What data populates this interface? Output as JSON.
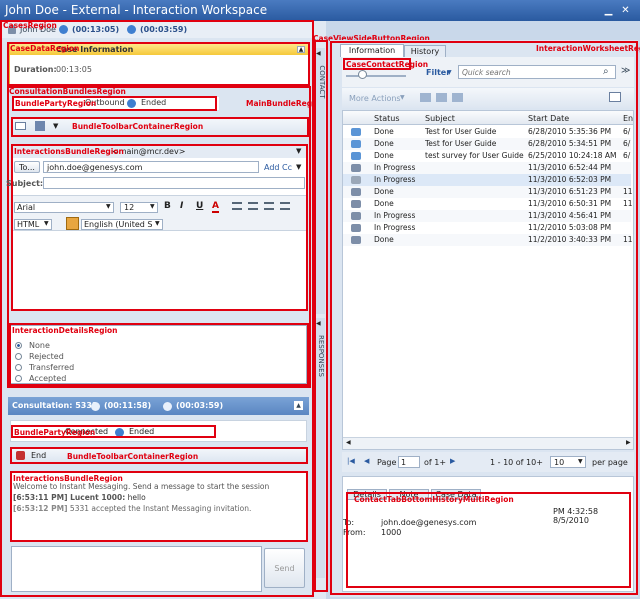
{
  "window": {
    "title": "John Doe - External - Interaction Workspace",
    "min": "▁",
    "close": "✕"
  },
  "cases_region_label": "CasesRegion",
  "party_tab": {
    "name": "John Doe",
    "timer1": "(00:13:05)",
    "timer2": "(00:03:59)"
  },
  "case_data": {
    "region_label": "CaseDataRegion",
    "title": "Case Information",
    "duration_label": "Duration:",
    "duration_value": "00:13:05"
  },
  "consultation_bundles_label": "ConsultationBundlesRegion",
  "main_bundle_label": "MainBundleRegion",
  "bundle_party": {
    "region_label": "BundlePartyRegion",
    "direction": "Outbound",
    "status": "Ended"
  },
  "bundle_toolbar_label": "BundleToolbarContainerRegion",
  "email_editor": {
    "region_label": "InteractionsBundleRegion",
    "from_value": "<main@mcr.dev>",
    "to_button": "To...",
    "to_value": "john.doe@genesys.com",
    "add_cc": "Add Cc",
    "subject_label": "Subject:",
    "font": "Arial",
    "size": "12",
    "format": "HTML",
    "language": "English (United S",
    "bold": "B",
    "italic": "I",
    "underline": "U",
    "color_a": "A"
  },
  "interaction_details": {
    "region_label": "InteractionDetailsRegion",
    "options": [
      "None",
      "Rejected",
      "Transferred",
      "Accepted"
    ]
  },
  "consultation": {
    "title": "Consultation: 5331",
    "timer1": "(00:11:58)",
    "timer2": "(00:03:59)"
  },
  "consult_party": {
    "region_label": "BundlePartyRegion",
    "status1": "Connected",
    "status2": "Ended"
  },
  "consult_toolbar": {
    "end_label": "End",
    "region_label": "BundleToolbarContainerRegion"
  },
  "chat": {
    "region_label": "InteractionsBundleRegion",
    "welcome": "Welcome to Instant Messaging. Send a message to start the session",
    "line1_time": "[6:53:11 PM] Lucent 1000:",
    "line1_text": "hello",
    "line2_time": "[6:53:12 PM]",
    "line2_text": "5331 accepted the Instant Messaging invitation.",
    "send": "Send"
  },
  "contact_strip": "CONTACT",
  "responses_strip": "RESPONSES",
  "side_button_label": "CaseViewSideButtonRegion",
  "worksheet_label": "InteractionWorksheetRegion",
  "right_tabs": {
    "information": "Information",
    "history": "History"
  },
  "case_contact_label": "CaseContactRegion",
  "filter": {
    "label": "Filter",
    "placeholder": "Quick search"
  },
  "more_actions": "More Actions",
  "history_table": {
    "columns": [
      "Status",
      "Subject",
      "Start Date",
      "En"
    ],
    "rows": [
      {
        "icon": "chat",
        "status": "Done",
        "subject": "Test for User Guide",
        "start": "6/28/2010 5:35:36 PM",
        "end": "6/"
      },
      {
        "icon": "chat",
        "status": "Done",
        "subject": "Test for User Guide",
        "start": "6/28/2010 5:34:51 PM",
        "end": "6/"
      },
      {
        "icon": "chat",
        "status": "Done",
        "subject": "test survey for User Guide",
        "start": "6/25/2010 10:24:18 AM",
        "end": "6/"
      },
      {
        "icon": "phone",
        "status": "In Progress",
        "subject": "",
        "start": "11/3/2010 6:52:44 PM",
        "end": ""
      },
      {
        "icon": "mail",
        "status": "In Progress",
        "subject": "",
        "start": "11/3/2010 6:52:03 PM",
        "end": ""
      },
      {
        "icon": "phone",
        "status": "Done",
        "subject": "",
        "start": "11/3/2010 6:51:23 PM",
        "end": "11"
      },
      {
        "icon": "phone",
        "status": "Done",
        "subject": "",
        "start": "11/3/2010 6:50:31 PM",
        "end": "11"
      },
      {
        "icon": "phone",
        "status": "In Progress",
        "subject": "",
        "start": "11/3/2010 4:56:41 PM",
        "end": ""
      },
      {
        "icon": "phone",
        "status": "In Progress",
        "subject": "",
        "start": "11/2/2010 5:03:08 PM",
        "end": ""
      },
      {
        "icon": "phone",
        "status": "Done",
        "subject": "",
        "start": "11/2/2010 3:40:33 PM",
        "end": "11"
      }
    ]
  },
  "pager": {
    "page_label": "Page",
    "page_value": "1",
    "of": "of 1+",
    "range": "1 - 10 of 10+",
    "per_page_value": "10",
    "per_page": "per page"
  },
  "bottom_tabs": [
    "Details",
    "Note",
    "Case Data"
  ],
  "contact_bottom_label": "ContactTabBottomHistoryMultiRegion",
  "detail": {
    "date": "PM 4:32:58 8/5/2010",
    "to_label": "To:",
    "to_value": "john.doe@genesys.com",
    "from_label": "From:",
    "from_value": "1000"
  },
  "colors": {
    "region_outline": "#e00010",
    "title_bar": "#2a5aa0",
    "header_blue": "#5a86c2",
    "case_header": "#f7d24a"
  }
}
